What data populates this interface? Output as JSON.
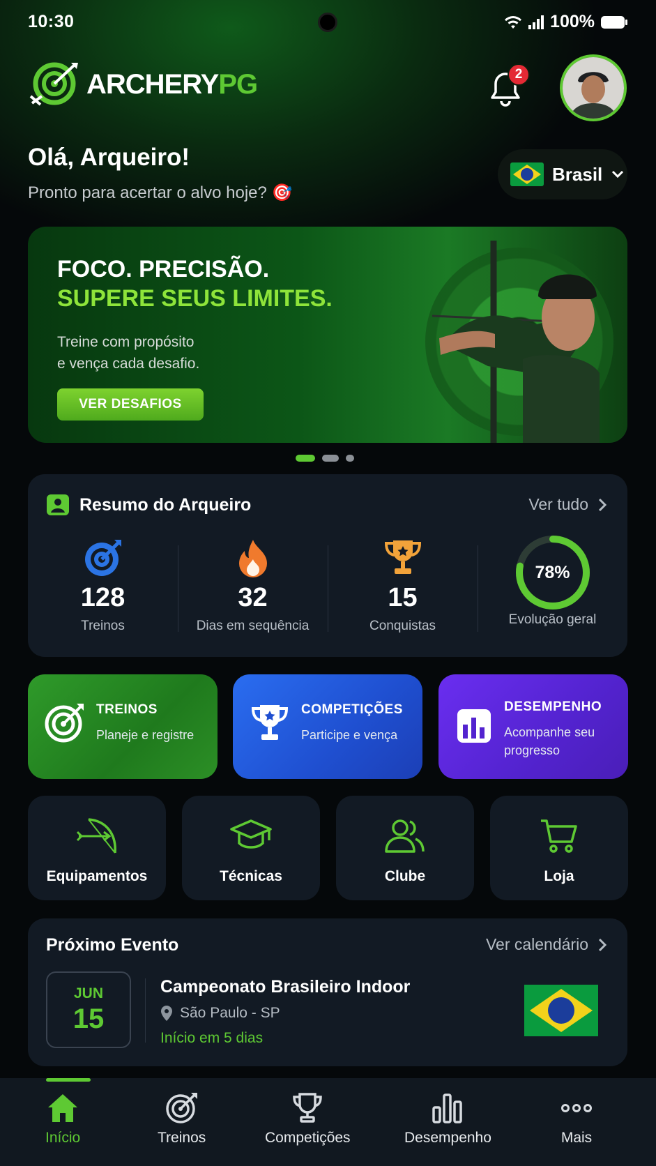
{
  "status_bar": {
    "time": "10:30",
    "battery": "100%"
  },
  "header": {
    "logo_part1": "ARCHERY",
    "logo_part2": "PG",
    "notification_count": "2"
  },
  "greeting": {
    "title": "Olá, Arqueiro!",
    "subtitle": "Pronto para acertar o alvo hoje? 🎯",
    "country": "Brasil"
  },
  "hero": {
    "line1": "FOCO. PRECISÃO.",
    "line2": "SUPERE SEUS LIMITES.",
    "text1": "Treine com propósito",
    "text2": "e vença cada desafio.",
    "button": "VER DESAFIOS",
    "slide_count": 3,
    "active_slide": 1
  },
  "summary": {
    "title": "Resumo do Arqueiro",
    "link": "Ver tudo",
    "stats": [
      {
        "icon": "target-icon",
        "value": "128",
        "label": "Treinos"
      },
      {
        "icon": "flame-icon",
        "value": "32",
        "label": "Dias em sequência"
      },
      {
        "icon": "trophy-icon",
        "value": "15",
        "label": "Conquistas"
      },
      {
        "icon": "progress-ring",
        "value": "78%",
        "label": "Evolução geral",
        "fraction": 0.78
      }
    ]
  },
  "actions": [
    {
      "title": "TREINOS",
      "subtitle": "Planeje e registre",
      "color": "#2f9a2a"
    },
    {
      "title": "COMPETIÇÕES",
      "subtitle": "Participe e vença",
      "color": "#2a6df0"
    },
    {
      "title": "DESEMPENHO",
      "subtitle": "Acompanhe seu progresso",
      "color": "#6a2ef0"
    }
  ],
  "shortcuts": [
    {
      "label": "Equipamentos",
      "icon": "bow-icon"
    },
    {
      "label": "Técnicas",
      "icon": "graduation-cap-icon"
    },
    {
      "label": "Clube",
      "icon": "users-icon"
    },
    {
      "label": "Loja",
      "icon": "cart-icon"
    }
  ],
  "event": {
    "title": "Próximo Evento",
    "link": "Ver calendário",
    "month": "JUN",
    "day": "15",
    "name": "Campeonato Brasileiro Indoor",
    "location": "São Paulo - SP",
    "starts": "Início em 5 dias"
  },
  "nav": [
    {
      "label": "Início",
      "icon": "home-icon",
      "active": true
    },
    {
      "label": "Treinos",
      "icon": "target-icon"
    },
    {
      "label": "Competições",
      "icon": "trophy-icon"
    },
    {
      "label": "Desempenho",
      "icon": "bar-chart-icon"
    },
    {
      "label": "Mais",
      "icon": "more-icon"
    }
  ],
  "colors": {
    "accent": "#5ec933",
    "card": "#121a24",
    "badge": "#e42a35"
  }
}
